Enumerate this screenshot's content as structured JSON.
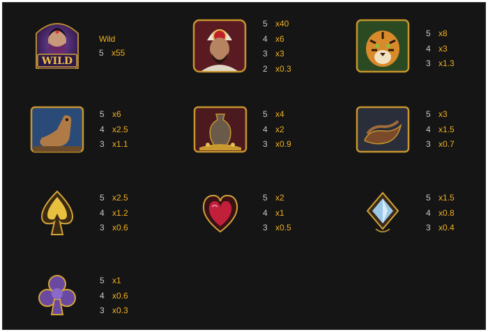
{
  "paytable": {
    "symbols": [
      {
        "id": "wild",
        "name": "wild-icon",
        "label": "Wild",
        "icon_text": "WILD",
        "pays": [
          {
            "count": "5",
            "mult": "x55"
          }
        ]
      },
      {
        "id": "sultan",
        "name": "sultan-icon",
        "pays": [
          {
            "count": "5",
            "mult": "x40"
          },
          {
            "count": "4",
            "mult": "x6"
          },
          {
            "count": "3",
            "mult": "x3"
          },
          {
            "count": "2",
            "mult": "x0.3"
          }
        ]
      },
      {
        "id": "tiger",
        "name": "tiger-icon",
        "pays": [
          {
            "count": "5",
            "mult": "x8"
          },
          {
            "count": "4",
            "mult": "x3"
          },
          {
            "count": "3",
            "mult": "x1.3"
          }
        ]
      },
      {
        "id": "camel",
        "name": "camel-icon",
        "pays": [
          {
            "count": "5",
            "mult": "x6"
          },
          {
            "count": "4",
            "mult": "x2.5"
          },
          {
            "count": "3",
            "mult": "x1.1"
          }
        ]
      },
      {
        "id": "vase",
        "name": "vase-icon",
        "pays": [
          {
            "count": "5",
            "mult": "x4"
          },
          {
            "count": "4",
            "mult": "x2"
          },
          {
            "count": "3",
            "mult": "x0.9"
          }
        ]
      },
      {
        "id": "slippers",
        "name": "slippers-icon",
        "pays": [
          {
            "count": "5",
            "mult": "x3"
          },
          {
            "count": "4",
            "mult": "x1.5"
          },
          {
            "count": "3",
            "mult": "x0.7"
          }
        ]
      },
      {
        "id": "spade",
        "name": "spade-icon",
        "pays": [
          {
            "count": "5",
            "mult": "x2.5"
          },
          {
            "count": "4",
            "mult": "x1.2"
          },
          {
            "count": "3",
            "mult": "x0.6"
          }
        ]
      },
      {
        "id": "heart",
        "name": "heart-icon",
        "pays": [
          {
            "count": "5",
            "mult": "x2"
          },
          {
            "count": "4",
            "mult": "x1"
          },
          {
            "count": "3",
            "mult": "x0.5"
          }
        ]
      },
      {
        "id": "diamond",
        "name": "diamond-icon",
        "pays": [
          {
            "count": "5",
            "mult": "x1.5"
          },
          {
            "count": "4",
            "mult": "x0.8"
          },
          {
            "count": "3",
            "mult": "x0.4"
          }
        ]
      },
      {
        "id": "club",
        "name": "club-icon",
        "pays": [
          {
            "count": "5",
            "mult": "x1"
          },
          {
            "count": "4",
            "mult": "x0.6"
          },
          {
            "count": "3",
            "mult": "x0.3"
          }
        ]
      }
    ]
  },
  "colors": {
    "background": "#151515",
    "count_text": "#c8c8c8",
    "multiplier_text": "#f0b020",
    "frame_gold": "#c8962e"
  }
}
